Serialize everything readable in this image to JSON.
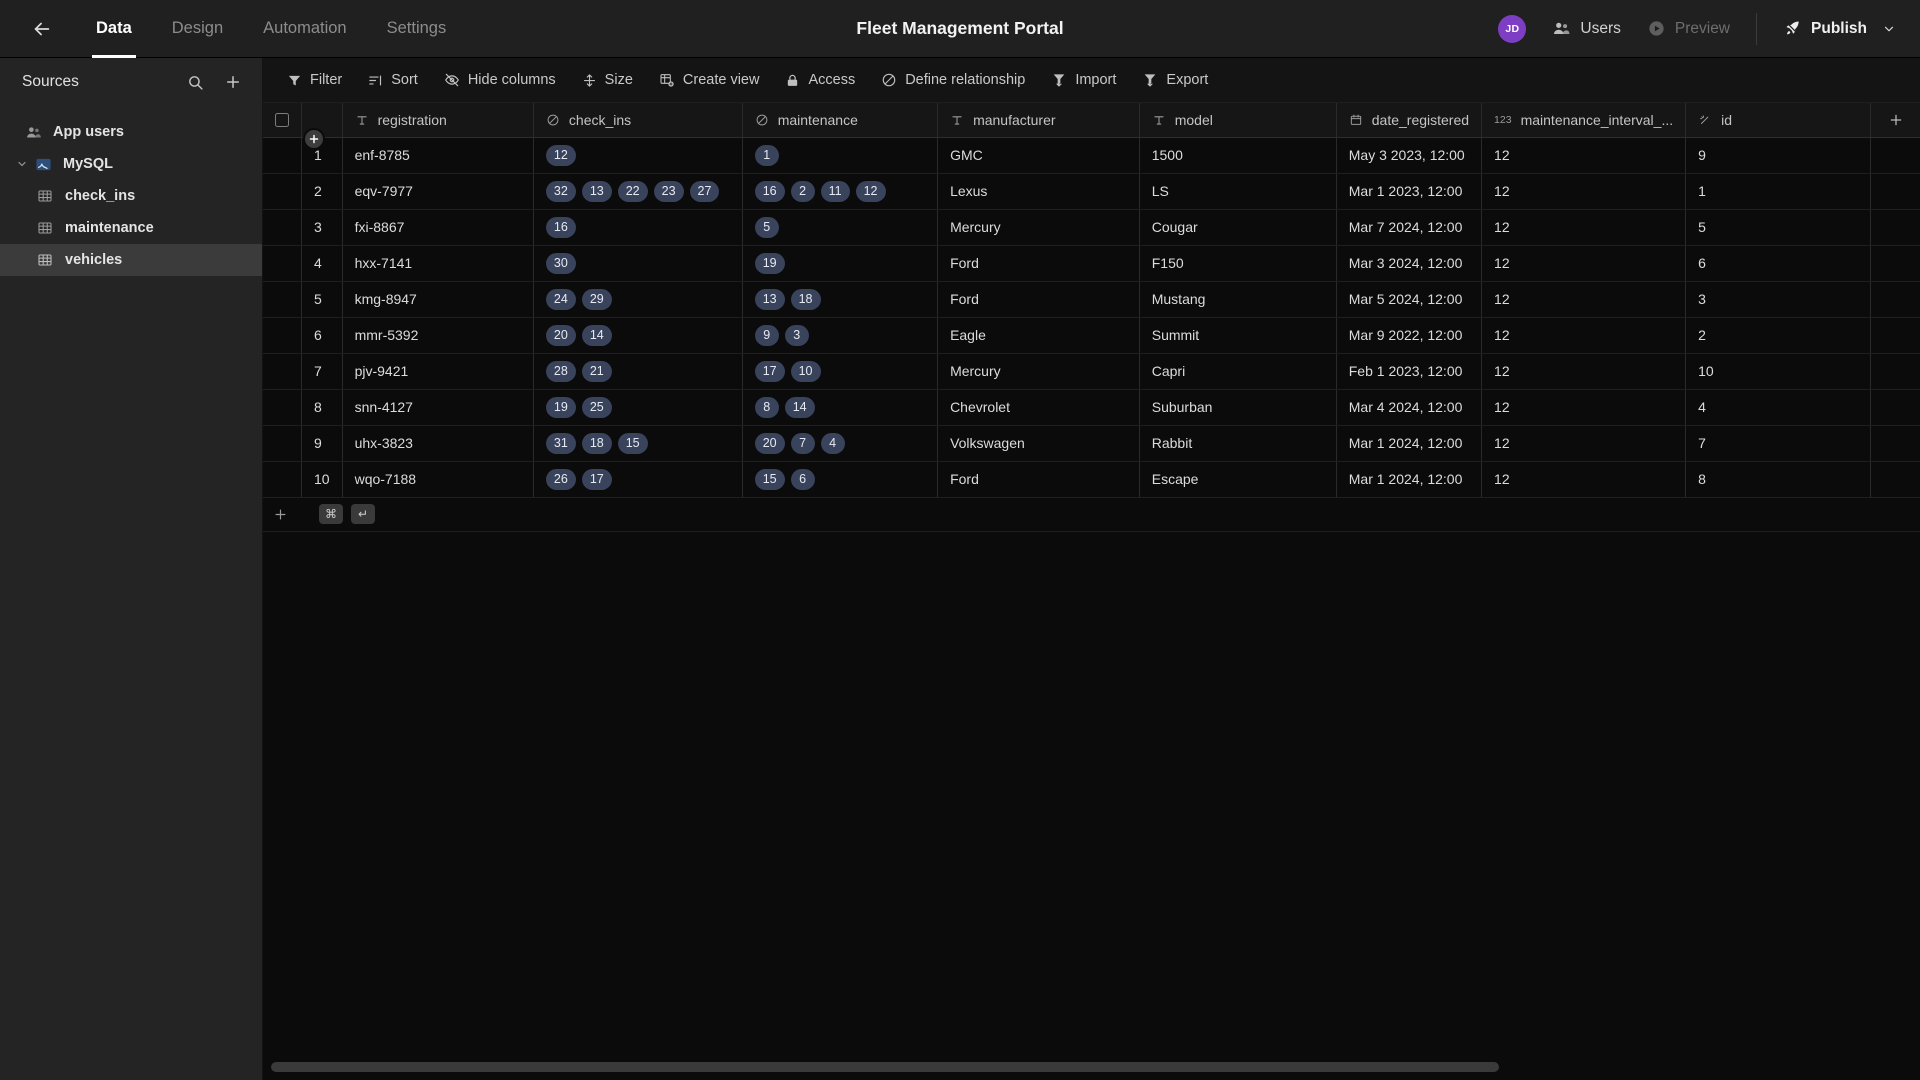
{
  "topbar": {
    "back_icon": "arrow-left-icon",
    "tabs": [
      {
        "label": "Data",
        "active": true
      },
      {
        "label": "Design",
        "active": false
      },
      {
        "label": "Automation",
        "active": false
      },
      {
        "label": "Settings",
        "active": false
      }
    ],
    "app_title": "Fleet Management Portal",
    "avatar_initials": "JD",
    "avatar_color": "#7e3ec4",
    "users_label": "Users",
    "preview_label": "Preview",
    "publish_label": "Publish"
  },
  "sidebar": {
    "title": "Sources",
    "search_icon": "search-icon",
    "add_icon": "plus-icon",
    "items": [
      {
        "label": "App users",
        "icon": "users-icon",
        "level": 0,
        "selected": false,
        "expandable": false
      },
      {
        "label": "MySQL",
        "icon": "mysql-icon",
        "level": 0,
        "selected": false,
        "expandable": true,
        "expanded": true
      },
      {
        "label": "check_ins",
        "icon": "table-icon",
        "level": 1,
        "selected": false,
        "expandable": false
      },
      {
        "label": "maintenance",
        "icon": "table-icon",
        "level": 1,
        "selected": false,
        "expandable": false
      },
      {
        "label": "vehicles",
        "icon": "table-icon",
        "level": 1,
        "selected": true,
        "expandable": false
      }
    ]
  },
  "grid_toolbar": [
    {
      "label": "Filter",
      "icon": "filter-icon"
    },
    {
      "label": "Sort",
      "icon": "sort-icon"
    },
    {
      "label": "Hide columns",
      "icon": "eye-off-icon"
    },
    {
      "label": "Size",
      "icon": "row-height-icon"
    },
    {
      "label": "Create view",
      "icon": "create-view-icon"
    },
    {
      "label": "Access",
      "icon": "lock-icon"
    },
    {
      "label": "Define relationship",
      "icon": "relationship-icon"
    },
    {
      "label": "Import",
      "icon": "import-icon"
    },
    {
      "label": "Export",
      "icon": "export-icon"
    }
  ],
  "table": {
    "columns": [
      {
        "name": "registration",
        "type_icon": "text-type-icon",
        "align": "left"
      },
      {
        "name": "check_ins",
        "type_icon": "relation-type-icon",
        "align": "left"
      },
      {
        "name": "maintenance",
        "type_icon": "relation-type-icon",
        "align": "left"
      },
      {
        "name": "manufacturer",
        "type_icon": "text-type-icon",
        "align": "left"
      },
      {
        "name": "model",
        "type_icon": "text-type-icon",
        "align": "left"
      },
      {
        "name": "date_registered",
        "type_icon": "date-type-icon",
        "align": "left"
      },
      {
        "name": "maintenance_interval_...",
        "type_icon": "number-type-icon",
        "align": "right"
      },
      {
        "name": "id",
        "type_icon": "autonumber-type-icon",
        "align": "right"
      }
    ],
    "add_column_icon": "plus-icon",
    "select_all_icon": "checkbox-icon",
    "rows": [
      {
        "n": "1",
        "registration": "enf-8785",
        "check_ins": [
          "12"
        ],
        "maintenance": [
          "1"
        ],
        "manufacturer": "GMC",
        "model": "1500",
        "date_registered": "May 3 2023, 12:00",
        "maintenance_interval": "12",
        "id": "9"
      },
      {
        "n": "2",
        "registration": "eqv-7977",
        "check_ins": [
          "32",
          "13",
          "22",
          "23",
          "27"
        ],
        "maintenance": [
          "16",
          "2",
          "11",
          "12"
        ],
        "manufacturer": "Lexus",
        "model": "LS",
        "date_registered": "Mar 1 2023, 12:00",
        "maintenance_interval": "12",
        "id": "1"
      },
      {
        "n": "3",
        "registration": "fxi-8867",
        "check_ins": [
          "16"
        ],
        "maintenance": [
          "5"
        ],
        "manufacturer": "Mercury",
        "model": "Cougar",
        "date_registered": "Mar 7 2024, 12:00",
        "maintenance_interval": "12",
        "id": "5"
      },
      {
        "n": "4",
        "registration": "hxx-7141",
        "check_ins": [
          "30"
        ],
        "maintenance": [
          "19"
        ],
        "manufacturer": "Ford",
        "model": "F150",
        "date_registered": "Mar 3 2024, 12:00",
        "maintenance_interval": "12",
        "id": "6"
      },
      {
        "n": "5",
        "registration": "kmg-8947",
        "check_ins": [
          "24",
          "29"
        ],
        "maintenance": [
          "13",
          "18"
        ],
        "manufacturer": "Ford",
        "model": "Mustang",
        "date_registered": "Mar 5 2024, 12:00",
        "maintenance_interval": "12",
        "id": "3"
      },
      {
        "n": "6",
        "registration": "mmr-5392",
        "check_ins": [
          "20",
          "14"
        ],
        "maintenance": [
          "9",
          "3"
        ],
        "manufacturer": "Eagle",
        "model": "Summit",
        "date_registered": "Mar 9 2022, 12:00",
        "maintenance_interval": "12",
        "id": "2"
      },
      {
        "n": "7",
        "registration": "pjv-9421",
        "check_ins": [
          "28",
          "21"
        ],
        "maintenance": [
          "17",
          "10"
        ],
        "manufacturer": "Mercury",
        "model": "Capri",
        "date_registered": "Feb 1 2023, 12:00",
        "maintenance_interval": "12",
        "id": "10"
      },
      {
        "n": "8",
        "registration": "snn-4127",
        "check_ins": [
          "19",
          "25"
        ],
        "maintenance": [
          "8",
          "14"
        ],
        "manufacturer": "Chevrolet",
        "model": "Suburban",
        "date_registered": "Mar 4 2024, 12:00",
        "maintenance_interval": "12",
        "id": "4"
      },
      {
        "n": "9",
        "registration": "uhx-3823",
        "check_ins": [
          "31",
          "18",
          "15"
        ],
        "maintenance": [
          "20",
          "7",
          "4"
        ],
        "manufacturer": "Volkswagen",
        "model": "Rabbit",
        "date_registered": "Mar 1 2024, 12:00",
        "maintenance_interval": "12",
        "id": "7"
      },
      {
        "n": "10",
        "registration": "wqo-7188",
        "check_ins": [
          "26",
          "17"
        ],
        "maintenance": [
          "15",
          "6"
        ],
        "manufacturer": "Ford",
        "model": "Escape",
        "date_registered": "Mar 1 2024, 12:00",
        "maintenance_interval": "12",
        "id": "8"
      }
    ],
    "add_row": {
      "plus_icon": "plus-icon",
      "keycaps": [
        "⌘",
        "↵"
      ]
    }
  },
  "colors": {
    "accent": "#7e3ec4",
    "badge_bg": "#39435c",
    "topbar_bg": "#202020",
    "sidebar_bg": "#242424",
    "grid_bg": "#0b0b0b"
  },
  "scrollbar": {
    "horizontal_thumb_percent": 75
  }
}
